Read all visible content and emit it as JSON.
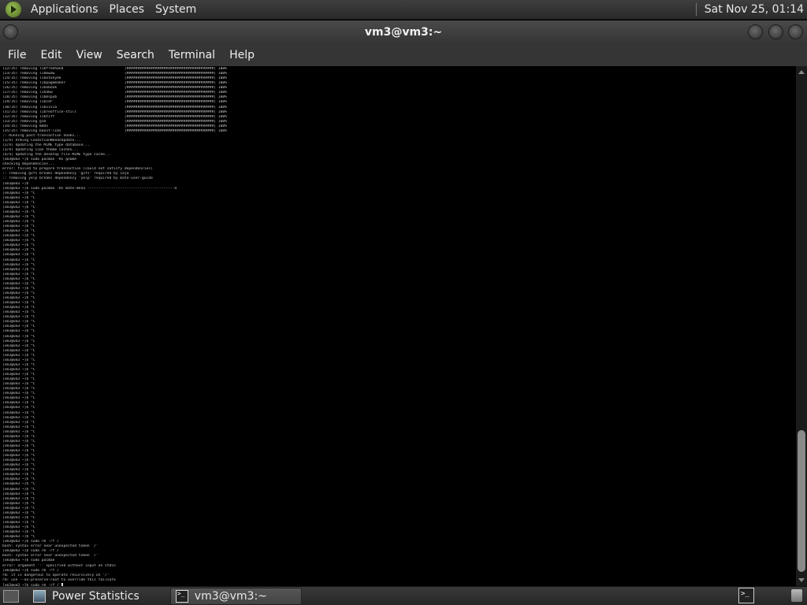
{
  "top_panel": {
    "menus": [
      "Applications",
      "Places",
      "System"
    ],
    "clock": "Sat Nov 25, 01:14"
  },
  "window": {
    "title": "vm3@vm3:~"
  },
  "menubar": [
    "File",
    "Edit",
    "View",
    "Search",
    "Terminal",
    "Help"
  ],
  "terminal": {
    "lines": [
      "(22/35) removing libfreehand                            [########################################] 100%",
      "(23/35) removing libmwaw                                [########################################] 100%",
      "(24/35) removing libetonyek                             [########################################] 100%",
      "(25/35) removing libpagemaker                           [########################################] 100%",
      "(26/35) removing libebook                               [########################################] 100%",
      "(27/35) removing libabw                                 [########################################] 100%",
      "(28/35) removing libmspub                               [########################################] 100%",
      "(29/35) removing libcdr                                 [########################################] 100%",
      "(30/35) removing libvisio                               [########################################] 100%",
      "(31/35) removing libreoffice-still                      [########################################] 100%",
      "(32/35) removing libtiff                                [########################################] 100%",
      "(33/35) removing glm                                    [########################################] 100%",
      "(34/35) removing mdds                                   [########################################] 100%",
      "(35/35) removing boost-libs                             [########################################] 100%",
      ":: Running post-transaction hooks...",
      "(1/4) Arming ConditionNeedsUpdate...",
      "(2/4) Updating the MIME type database...",
      "(3/4) Updating icon theme caches...",
      "(4/4) Updating the desktop file MIME type cache...",
      "[vm3@vm3 ~]$ sudo pacman -Rs gnome",
      "checking dependencies...",
      "error: failed to prepare transaction (could not satisfy dependencies)",
      ":: removing gvfs breaks dependency 'gvfs' required by caja",
      ":: removing yelp breaks dependency 'yelp' required by mate-user-guide",
      "[vm3@vm3 ~]$",
      "[vm3@vm3 ~]$ sudo pacman -Rs mate-menu ----------------------------------------O"
    ],
    "prompt_line": "[vm3@vm3 ~]$ ^C",
    "prompt_repeat": 73,
    "tail_lines": [
      "[vm3@vm3 ~]$ sudo rm -rf /",
      "bash: syntax error near unexpected token `/'",
      "[vm3@vm3 ~]$ sudo rm -rf /",
      "bash: syntax error near unexpected token `/'",
      "[vm3@vm3 ~]$ sudo pacman",
      "error: argument '-' specified without input on stdin",
      "[vm3@vm3 ~]$ sudo rm -rf /",
      "rm: it is dangerous to operate recursively on '/'",
      "rm: use --no-preserve-root to override this failsafe",
      "[vm3@vm3 ~]$ sudo rm -rf /"
    ]
  },
  "bottom_panel": {
    "tasks": [
      {
        "label": "Power Statistics"
      },
      {
        "label": "vm3@vm3:~"
      }
    ]
  }
}
